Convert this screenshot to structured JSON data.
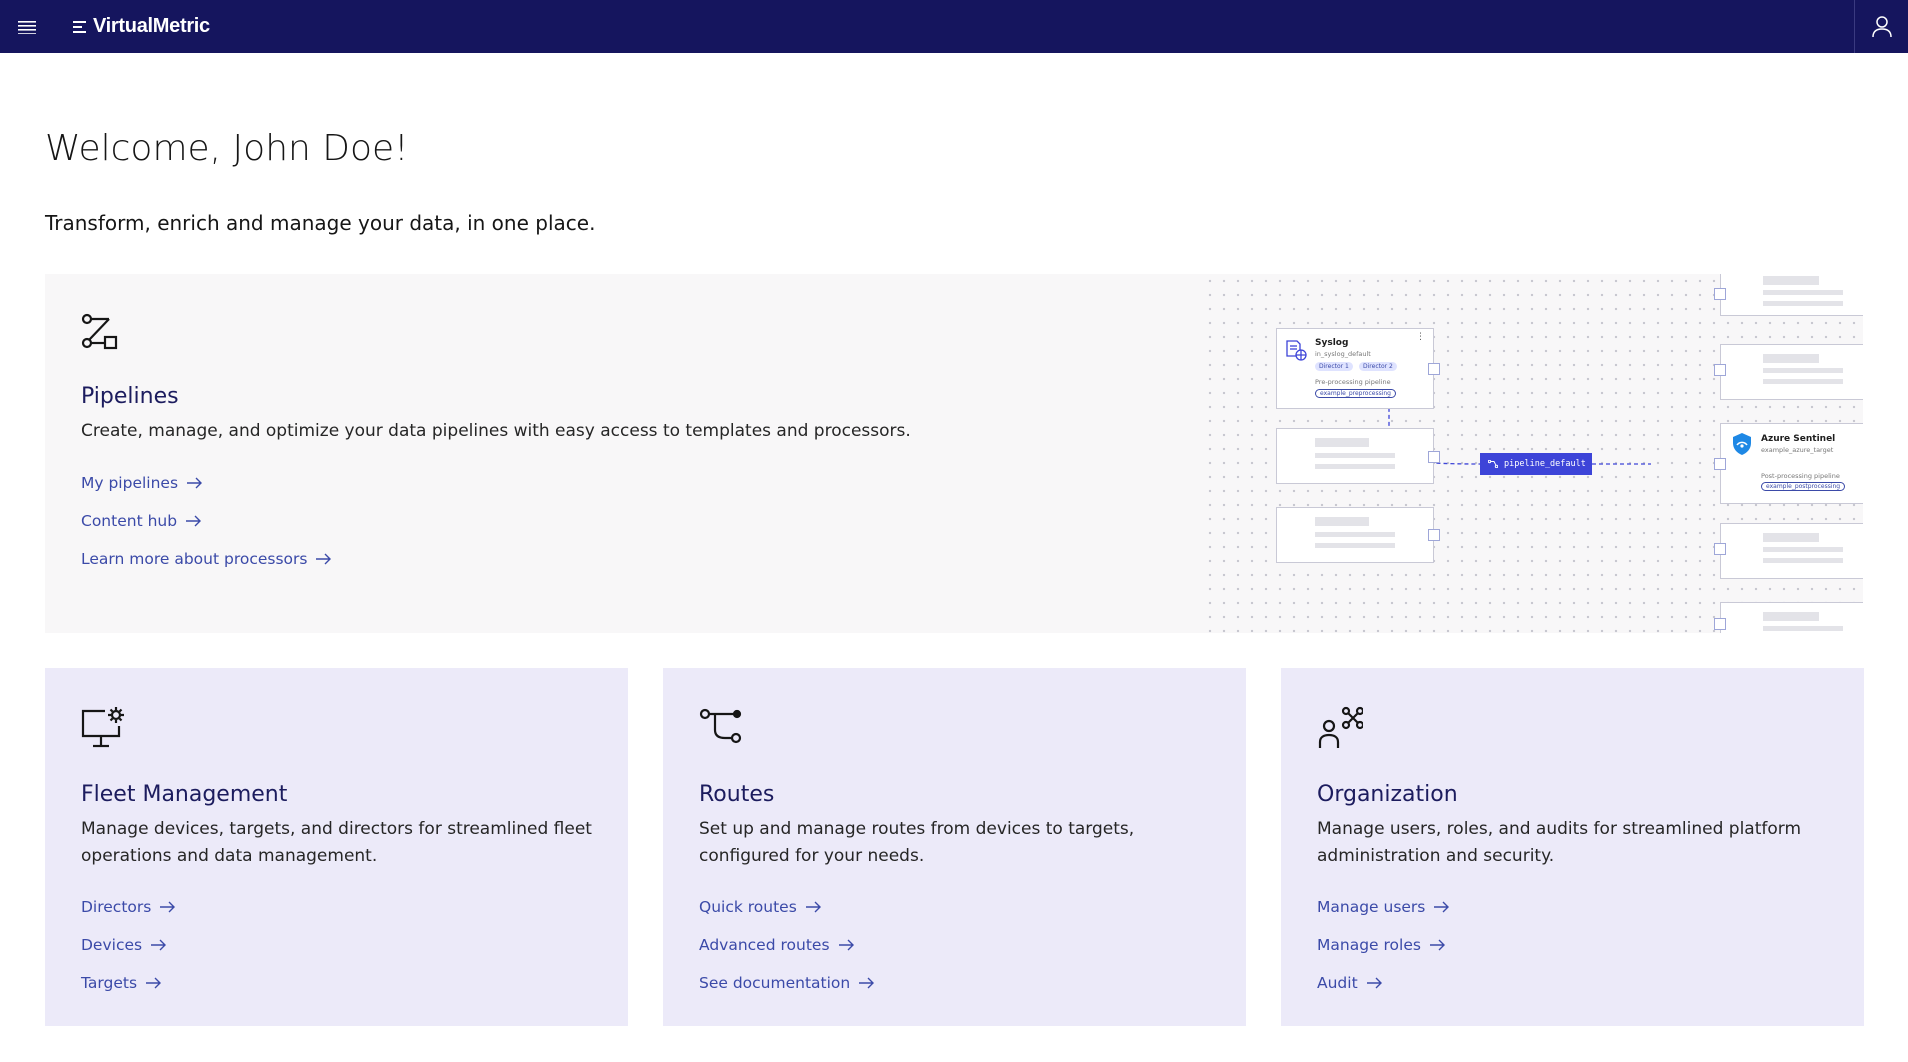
{
  "header": {
    "brand": "VirtualMetric"
  },
  "welcome": "Welcome, John Doe!",
  "tagline": "Transform, enrich and manage your data, in one place.",
  "pipelines": {
    "title": "Pipelines",
    "description": "Create, manage, and optimize your data pipelines with easy access to templates and processors.",
    "links": [
      "My pipelines",
      "Content hub",
      "Learn more about processors"
    ],
    "diagram": {
      "source_title": "Syslog",
      "source_sub": "in_syslog_default",
      "tag1": "Director 1",
      "tag2": "Director 2",
      "pre_label": "Pre-processing pipeline",
      "pre_tag": "example_preprocessing",
      "pipeline_chip": "pipeline_default",
      "target_title": "Azure Sentinel",
      "target_sub": "example_azure_target",
      "post_label": "Post-processing pipeline",
      "post_tag": "example_postprocessing"
    }
  },
  "fleet": {
    "title": "Fleet Management",
    "description": "Manage devices, targets, and directors for streamlined fleet operations and data management.",
    "links": [
      "Directors",
      "Devices",
      "Targets"
    ]
  },
  "routes": {
    "title": "Routes",
    "description": "Set up and manage routes from devices to targets, configured for your needs.",
    "links": [
      "Quick routes",
      "Advanced routes",
      "See documentation"
    ]
  },
  "organization": {
    "title": "Organization",
    "description": "Manage users, roles, and audits for streamlined platform administration and security.",
    "links": [
      "Manage users",
      "Manage roles",
      "Audit"
    ]
  },
  "colors": {
    "header_bg": "#15155e",
    "link": "#3b4aa8",
    "card_bg": "#eceaf9",
    "hero_bg": "#f8f7f8",
    "chip": "#3d44d8"
  }
}
